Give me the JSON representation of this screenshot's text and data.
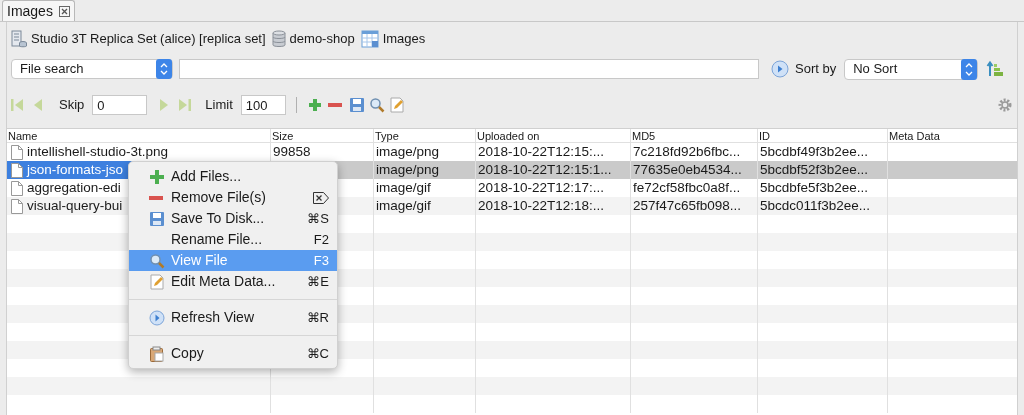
{
  "tab": {
    "label": "Images",
    "selected": true
  },
  "breadcrumb": [
    "Studio 3T Replica Set (alice) [replica set]",
    "demo-shop",
    "Images"
  ],
  "search": {
    "mode": "File search"
  },
  "sort": {
    "label": "Sort by",
    "value": "No Sort"
  },
  "pager": {
    "skip_label": "Skip",
    "skip": "0",
    "limit_label": "Limit",
    "limit": "100"
  },
  "table": {
    "columns": [
      "Name",
      "Size",
      "Type",
      "Uploaded on",
      "MD5",
      "ID",
      "Meta Data"
    ],
    "rows": [
      {
        "selected": false,
        "cells": [
          "intellishell-studio-3t.png",
          "99858",
          "image/png",
          "2018-10-22T12:15:...",
          "7c218fd92b6fbc...",
          "5bcdbf49f3b2ee...",
          ""
        ]
      },
      {
        "selected": true,
        "cells": [
          "json-formats-jso",
          "",
          "image/png",
          "2018-10-22T12:15:1...",
          "77635e0eb4534...",
          "5bcdbf52f3b2ee...",
          ""
        ]
      },
      {
        "selected": false,
        "cells": [
          "aggregation-edi",
          "",
          "image/gif",
          "2018-10-22T12:17:...",
          "fe72cf58fbc0a8f...",
          "5bcdbfe5f3b2ee...",
          ""
        ]
      },
      {
        "selected": false,
        "cells": [
          "visual-query-bui",
          "",
          "image/gif",
          "2018-10-22T12:18:...",
          "257f47c65fb098...",
          "5bcdc011f3b2ee...",
          ""
        ]
      }
    ]
  },
  "context_menu": [
    {
      "kind": "item",
      "label": "Add Files...",
      "selected": false
    },
    {
      "kind": "item",
      "label": "Remove File(s)",
      "selected": false
    },
    {
      "kind": "item",
      "label": "Save To Disk...",
      "shortcut": "⌘S",
      "selected": false
    },
    {
      "kind": "item",
      "label": "Rename File...",
      "shortcut": "F2",
      "selected": false
    },
    {
      "kind": "item",
      "label": "View File",
      "shortcut": "F3",
      "selected": true
    },
    {
      "kind": "item",
      "label": "Edit Meta Data...",
      "shortcut": "⌘E",
      "selected": false
    },
    {
      "kind": "separator"
    },
    {
      "kind": "item",
      "label": "Refresh View",
      "shortcut": "⌘R",
      "selected": false
    },
    {
      "kind": "separator"
    },
    {
      "kind": "item",
      "label": "Copy",
      "shortcut": "⌘C",
      "selected": false
    }
  ]
}
